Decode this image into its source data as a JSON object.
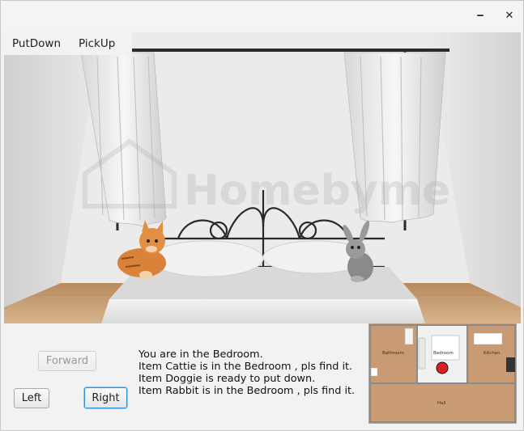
{
  "window": {
    "minimize_label": "‒",
    "close_label": "✕"
  },
  "menu": {
    "items": [
      {
        "label": "PutDown"
      },
      {
        "label": "PickUp"
      }
    ]
  },
  "scene": {
    "watermark": "Homebyme",
    "room": "Bedroom"
  },
  "controls": {
    "forward_label": "Forward",
    "left_label": "Left",
    "right_label": "Right"
  },
  "messages": [
    "You are in the Bedroom.",
    "Item Cattie is in the Bedroom , pls find it.",
    "Item Doggie is ready to put down.",
    "Item Rabbit is in the Bedroom , pls find it."
  ],
  "floor_plan": {
    "rooms": {
      "bathroom": "Bathroom",
      "bedroom": "Bedroom",
      "kitchen": "Kitchen",
      "hall": "Hall"
    },
    "marker_color": "#e02020"
  },
  "colors": {
    "focus": "#2e8fd6",
    "floor_wood": "#caa17a"
  }
}
